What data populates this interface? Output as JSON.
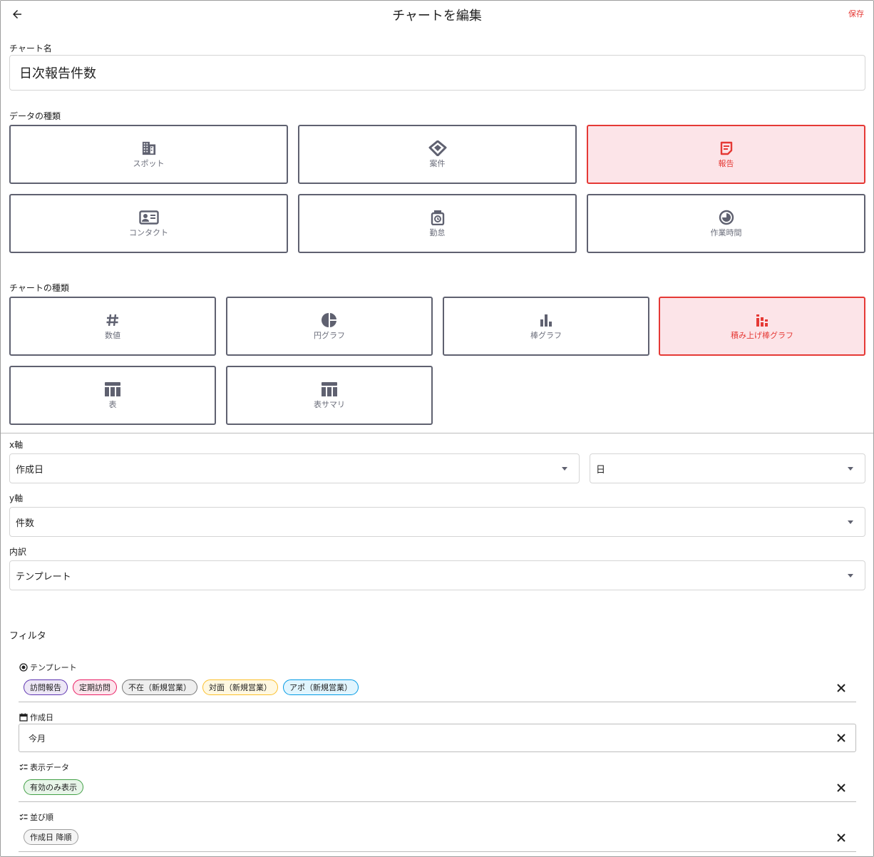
{
  "header": {
    "title": "チャートを編集",
    "save_label": "保存"
  },
  "chart_name": {
    "label": "チャート名",
    "value": "日次報告件数"
  },
  "data_types": {
    "label": "データの種類",
    "items": [
      {
        "label": "スポット",
        "icon": "building-icon"
      },
      {
        "label": "案件",
        "icon": "handshake-icon"
      },
      {
        "label": "報告",
        "icon": "note-icon",
        "selected": true
      },
      {
        "label": "コンタクト",
        "icon": "contact-card-icon"
      },
      {
        "label": "勤怠",
        "icon": "timeclock-icon"
      },
      {
        "label": "作業時間",
        "icon": "clock-icon"
      }
    ]
  },
  "chart_types": {
    "label": "チャートの種類",
    "items": [
      {
        "label": "数値",
        "icon": "hash-icon"
      },
      {
        "label": "円グラフ",
        "icon": "pie-chart-icon"
      },
      {
        "label": "棒グラフ",
        "icon": "bar-chart-icon"
      },
      {
        "label": "積み上げ棒グラフ",
        "icon": "stacked-bar-icon",
        "selected": true
      },
      {
        "label": "表",
        "icon": "table-icon"
      },
      {
        "label": "表サマリ",
        "icon": "table-summary-icon"
      }
    ]
  },
  "x_axis": {
    "label": "x軸",
    "field": "作成日",
    "unit": "日"
  },
  "y_axis": {
    "label": "y軸",
    "field": "件数"
  },
  "breakdown": {
    "label": "内訳",
    "field": "テンプレート"
  },
  "filter": {
    "title": "フィルタ",
    "template": {
      "label": "テンプレート",
      "chips": [
        {
          "label": "訪問報告",
          "border": "#5e35b1",
          "bg": "#ede7f6"
        },
        {
          "label": "定期訪問",
          "border": "#e91e63",
          "bg": "#fce4ec"
        },
        {
          "label": "不在（新規営業）",
          "border": "#757575",
          "bg": "#eeeeee"
        },
        {
          "label": "対面（新規営業）",
          "border": "#fbc02d",
          "bg": "#fff8e1"
        },
        {
          "label": "アポ（新規営業）",
          "border": "#039be5",
          "bg": "#e1f5fe"
        }
      ]
    },
    "created": {
      "label": "作成日",
      "value": "今月"
    },
    "display": {
      "label": "表示データ",
      "chip": {
        "label": "有効のみ表示",
        "border": "#43a047",
        "bg": "#e8f5e9"
      }
    },
    "sort": {
      "label": "並び順",
      "chip": {
        "label": "作成日 降順",
        "border": "#9e9e9e",
        "bg": "#f5f5f5"
      }
    }
  }
}
